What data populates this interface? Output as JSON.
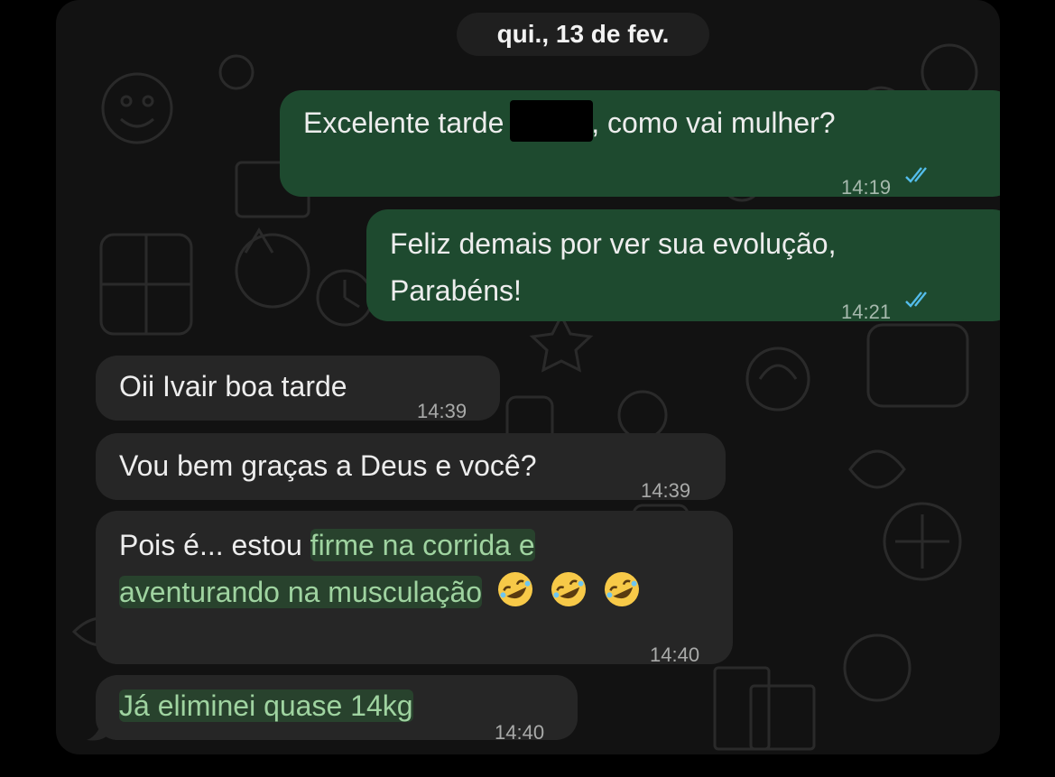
{
  "date_separator": "qui., 13 de fev.",
  "messages": [
    {
      "direction": "outgoing",
      "text_before": "Excelente tarde ",
      "text_after": ", como vai mulher?",
      "time": "14:19",
      "read": true
    },
    {
      "direction": "outgoing",
      "line1": "Feliz demais por ver sua evolução,",
      "line2": "Parabéns!",
      "time": "14:21",
      "read": true
    },
    {
      "direction": "incoming",
      "text": "Oii Ivair boa tarde",
      "time": "14:39"
    },
    {
      "direction": "incoming",
      "text": "Vou bem graças a Deus e você?",
      "time": "14:39"
    },
    {
      "direction": "incoming",
      "line1_plain": "Pois é... estou ",
      "line1_highlight": "firme na corrida e",
      "line2_highlight": "aventurando na musculação",
      "emojis": [
        "rolling-on-floor-laughing",
        "rolling-on-floor-laughing",
        "rolling-on-floor-laughing"
      ],
      "time": "14:40"
    },
    {
      "direction": "incoming",
      "text_highlight": "Já eliminei quase 14kg",
      "time": "14:40"
    }
  ],
  "colors": {
    "outgoing_bubble": "#1e4a2f",
    "incoming_bubble": "#262626",
    "read_ticks": "#53bdeb",
    "highlight_text": "#9fd3a0"
  },
  "icons": {
    "read_receipt": "double-check-icon",
    "emoji": "rolling-on-floor-laughing-emoji"
  }
}
